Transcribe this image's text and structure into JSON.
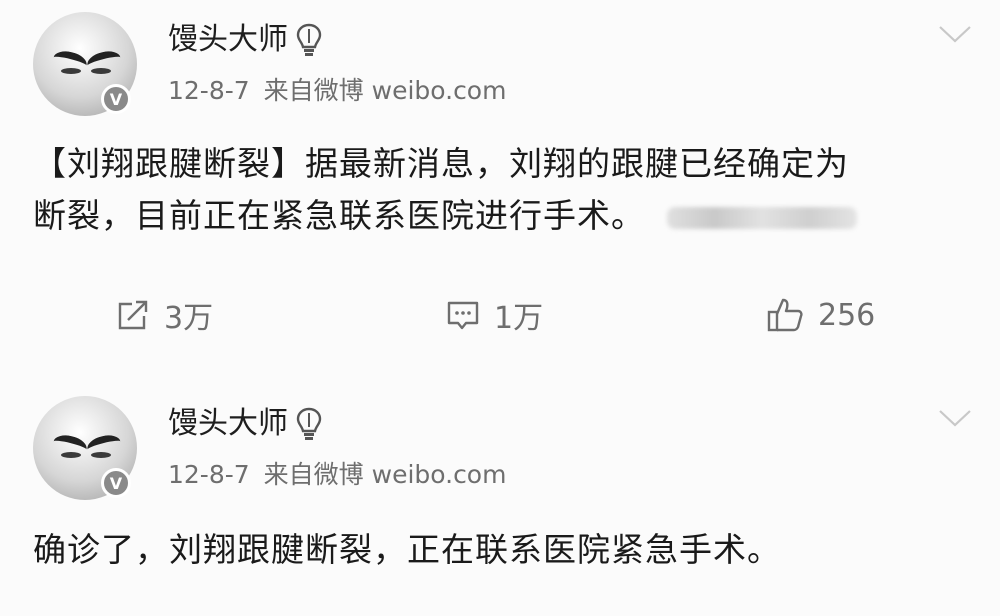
{
  "posts": [
    {
      "author": "馒头大师",
      "date": "12-8-7",
      "source": "来自微博 weibo.com",
      "text_line1": "【刘翔跟腱断裂】据最新消息，刘翔的跟腱已经确定为",
      "text_line2": "断裂，目前正在紧急联系医院进行手术。",
      "reposts": "3万",
      "comments": "1万",
      "likes": "256"
    },
    {
      "author": "馒头大师",
      "date": "12-8-7",
      "source": "来自微博 weibo.com",
      "text": "确诊了，刘翔跟腱断裂，正在联系医院紧急手术。"
    }
  ],
  "badge_letter": "V",
  "icons": {
    "verified": "verified-badge-icon",
    "bulb": "lightbulb-icon",
    "menu": "chevron-down-icon",
    "repost": "repost-icon",
    "comment": "comment-icon",
    "like": "thumbs-up-icon"
  },
  "colors": {
    "background": "#fbfbfb",
    "text": "#1a1a1a",
    "meta": "#6e6e6e",
    "badge": "#8a8a8a"
  }
}
